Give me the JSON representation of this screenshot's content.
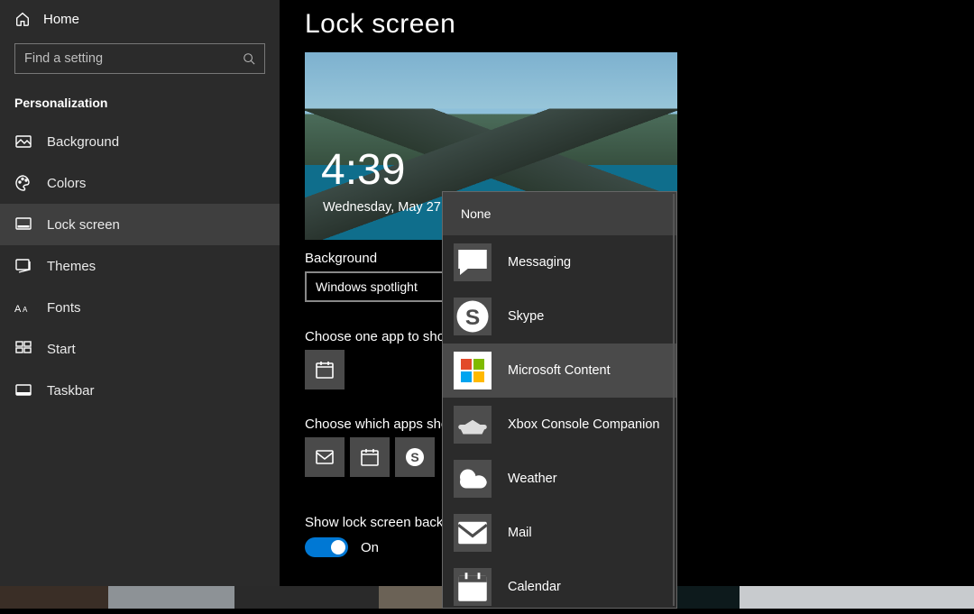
{
  "sidebar": {
    "home_label": "Home",
    "search_placeholder": "Find a setting",
    "section_label": "Personalization",
    "items": [
      {
        "id": "background",
        "label": "Background"
      },
      {
        "id": "colors",
        "label": "Colors"
      },
      {
        "id": "lock-screen",
        "label": "Lock screen",
        "active": true
      },
      {
        "id": "themes",
        "label": "Themes"
      },
      {
        "id": "fonts",
        "label": "Fonts"
      },
      {
        "id": "start",
        "label": "Start"
      },
      {
        "id": "taskbar",
        "label": "Taskbar"
      }
    ]
  },
  "page": {
    "title": "Lock screen",
    "preview": {
      "time": "4:39",
      "date": "Wednesday, May 27"
    },
    "background_label": "Background",
    "background_value": "Windows spotlight",
    "choose_one_label": "Choose one app to sho",
    "choose_which_label": "Choose which apps sho",
    "toggle_section_label": "Show lock screen backg",
    "toggle_state": "On",
    "quick_tiles": [
      {
        "icon": "mail"
      },
      {
        "icon": "calendar"
      },
      {
        "icon": "skype"
      }
    ]
  },
  "popup": {
    "none_label": "None",
    "items": [
      {
        "icon": "messaging",
        "label": "Messaging"
      },
      {
        "icon": "skype",
        "label": "Skype"
      },
      {
        "icon": "microsoft",
        "label": "Microsoft Content",
        "hover": true
      },
      {
        "icon": "xbox",
        "label": "Xbox Console Companion"
      },
      {
        "icon": "weather",
        "label": "Weather"
      },
      {
        "icon": "mail",
        "label": "Mail"
      },
      {
        "icon": "calendar",
        "label": "Calendar"
      }
    ]
  }
}
